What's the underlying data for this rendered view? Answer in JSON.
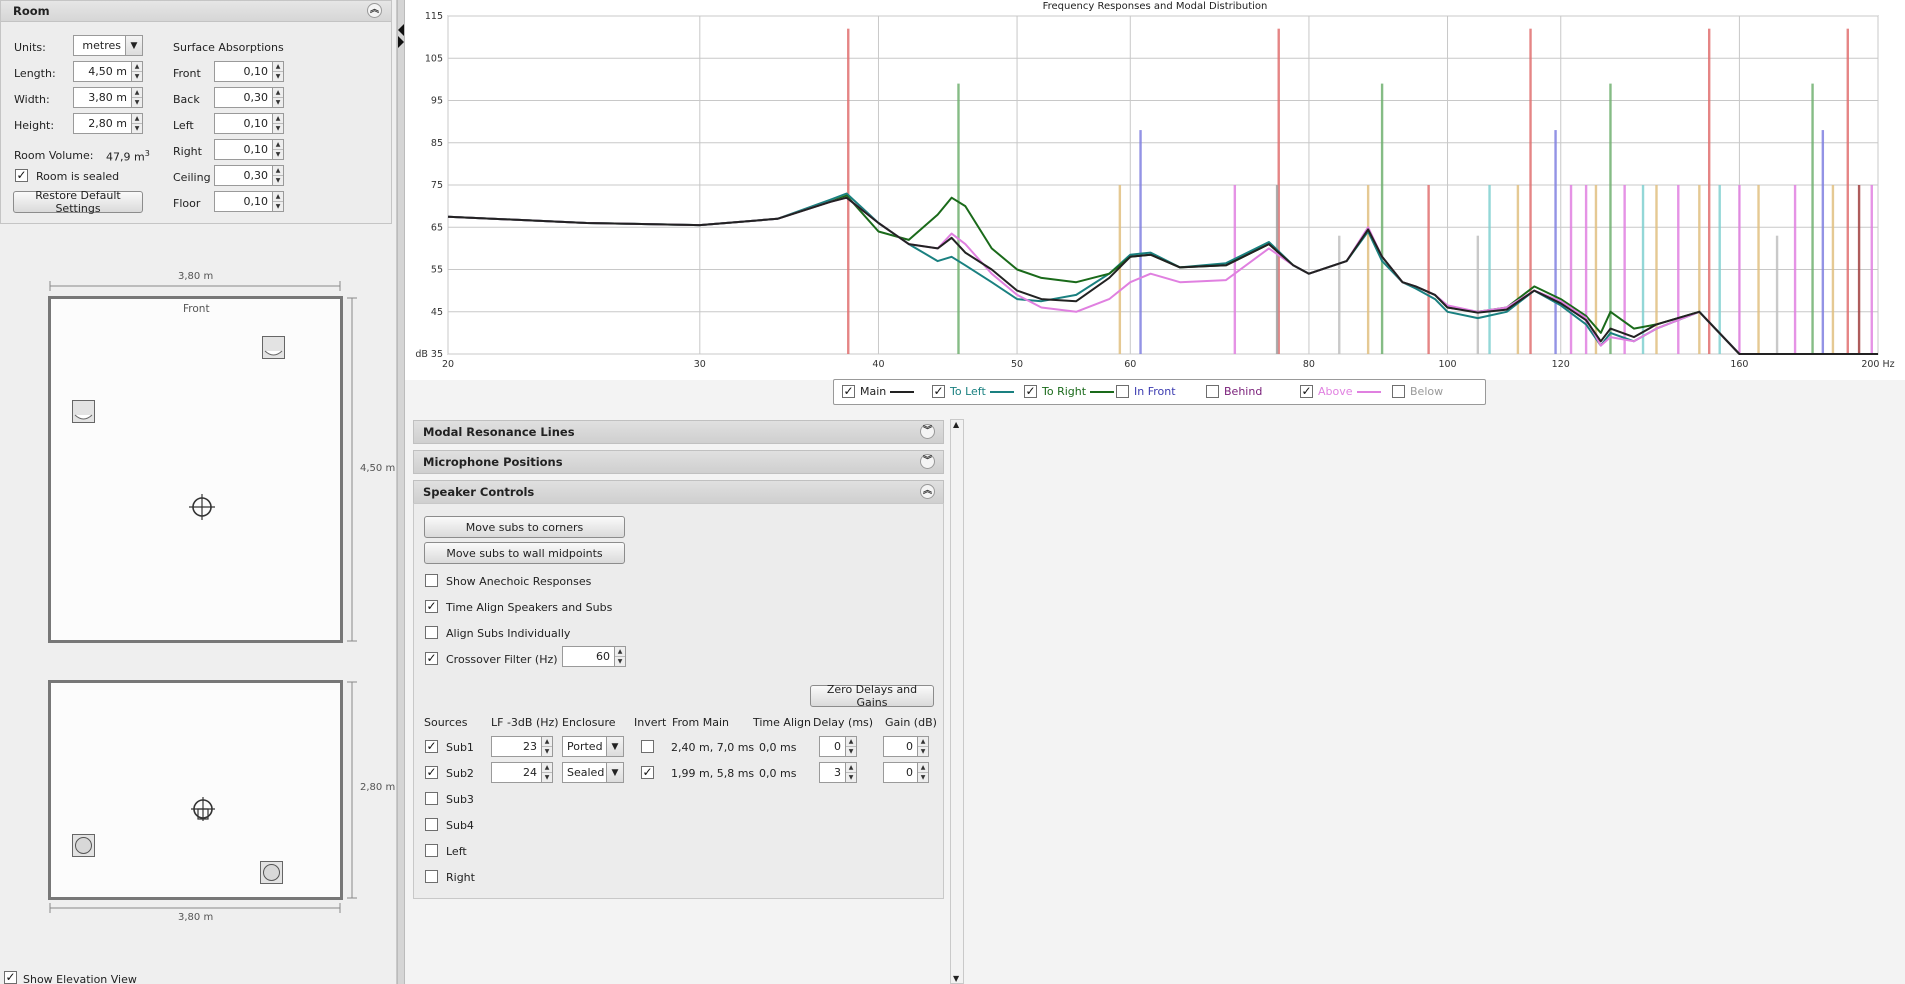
{
  "room": {
    "title": "Room",
    "units_label": "Units:",
    "units_value": "metres",
    "length_label": "Length:",
    "length_value": "4,50 m",
    "width_label": "Width:",
    "width_value": "3,80 m",
    "height_label": "Height:",
    "height_value": "2,80 m",
    "volume_label": "Room Volume:",
    "volume_value": "47,9 m",
    "volume_sup": "3",
    "sealed_label": "Room is sealed",
    "sealed_checked": true,
    "restore_label": "Restore Default Settings",
    "absorptions_title": "Surface Absorptions",
    "absorptions": [
      {
        "label": "Front",
        "value": "0,10"
      },
      {
        "label": "Back",
        "value": "0,30"
      },
      {
        "label": "Left",
        "value": "0,10"
      },
      {
        "label": "Right",
        "value": "0,10"
      },
      {
        "label": "Ceiling",
        "value": "0,30"
      },
      {
        "label": "Floor",
        "value": "0,10"
      }
    ]
  },
  "plan": {
    "top_width": "3,80 m",
    "front_label": "Front",
    "length": "4,50 m",
    "elev_height": "2,80 m",
    "elev_width": "3,80 m"
  },
  "elevation_toggle": {
    "label": "Show Elevation View",
    "checked": true
  },
  "chart_data": {
    "type": "line",
    "title": "Frequency Responses and Modal Distribution",
    "xlabel": "Hz",
    "ylabel": "dB",
    "x_scale": "log",
    "xlim": [
      20,
      200
    ],
    "ylim": [
      35,
      115
    ],
    "x_ticks": [
      "20",
      "30",
      "40",
      "50",
      "60",
      "80",
      "100",
      "120",
      "160",
      "200 Hz"
    ],
    "y_ticks": [
      "dB 35",
      "45",
      "55",
      "65",
      "75",
      "85",
      "95",
      "105",
      "115"
    ],
    "grid": true,
    "series": [
      {
        "name": "Main",
        "color": "#222222",
        "x": [
          20,
          25,
          30,
          34,
          37,
          38,
          40,
          42,
          44,
          45,
          46,
          48,
          50,
          52,
          55,
          58,
          60,
          62,
          65,
          70,
          75,
          78,
          80,
          85,
          88,
          90,
          93,
          95,
          98,
          100,
          105,
          110,
          115,
          120,
          125,
          128,
          130,
          135,
          140,
          150,
          160,
          200
        ],
        "y": [
          67.5,
          66,
          65.5,
          67,
          71,
          72,
          66,
          61,
          60,
          62.5,
          59,
          55,
          50,
          48,
          47.5,
          53,
          58,
          58.5,
          55.5,
          56,
          61,
          56,
          54,
          57,
          64.5,
          58,
          52,
          51,
          49,
          46,
          44.8,
          45.5,
          50,
          47,
          43,
          38,
          41,
          39,
          42,
          45,
          35,
          35
        ]
      },
      {
        "name": "To Left",
        "color": "#1a8080",
        "x": [
          20,
          25,
          30,
          34,
          37,
          38,
          40,
          42,
          44,
          45,
          46,
          48,
          50,
          52,
          55,
          58,
          60,
          62,
          65,
          70,
          75,
          78,
          80,
          85,
          88,
          90,
          93,
          95,
          98,
          100,
          105,
          110,
          115,
          120,
          125,
          128,
          130,
          135,
          140,
          150,
          160,
          200
        ],
        "y": [
          67.5,
          66,
          65.5,
          67,
          71.5,
          73,
          66,
          61,
          57,
          58,
          56,
          52,
          48,
          47.5,
          49,
          54,
          58.5,
          59,
          55.5,
          56.5,
          61.5,
          56,
          54,
          57,
          64,
          57,
          52,
          50.5,
          48,
          45,
          43.5,
          45,
          50,
          46.5,
          42,
          37,
          40,
          38,
          41,
          45,
          35,
          35
        ]
      },
      {
        "name": "To Right",
        "color": "#1a6a1a",
        "x": [
          20,
          25,
          30,
          34,
          37,
          38,
          40,
          42,
          44,
          45,
          46,
          48,
          50,
          52,
          55,
          58,
          60,
          62,
          65,
          70,
          75,
          78,
          80,
          85,
          88,
          90,
          93,
          95,
          98,
          100,
          105,
          110,
          115,
          120,
          125,
          128,
          130,
          135,
          140,
          150,
          160,
          200
        ],
        "y": [
          67.5,
          66,
          65.5,
          67,
          71,
          72.5,
          64,
          62,
          68,
          72,
          70,
          60,
          55,
          53,
          52,
          54,
          58,
          58.5,
          55.5,
          56,
          61,
          56,
          54,
          57,
          64.5,
          58,
          52,
          51,
          49,
          46,
          45,
          46,
          51,
          48,
          44,
          40,
          45,
          41,
          42,
          45,
          35,
          35
        ]
      },
      {
        "name": "In Front",
        "color": "#3b3bb0",
        "x": [],
        "y": [],
        "enabled": false
      },
      {
        "name": "Behind",
        "color": "#7a207a",
        "x": [],
        "y": [],
        "enabled": false
      },
      {
        "name": "Above",
        "color": "#e080e0",
        "x": [
          20,
          25,
          30,
          34,
          37,
          38,
          40,
          42,
          44,
          45,
          46,
          48,
          50,
          52,
          55,
          58,
          60,
          62,
          65,
          70,
          75,
          78,
          80,
          85,
          88,
          90,
          93,
          95,
          98,
          100,
          105,
          110,
          115,
          120,
          125,
          128,
          130,
          135,
          140,
          150,
          160,
          200
        ],
        "y": [
          67.5,
          66,
          65.5,
          67,
          71,
          72,
          66,
          61,
          60,
          63.5,
          61,
          54,
          49,
          46,
          45,
          48,
          52,
          54,
          52,
          52.5,
          60,
          56,
          54,
          57,
          65,
          58,
          52,
          51,
          49,
          46.5,
          45,
          46,
          50,
          47.5,
          43.5,
          37,
          39,
          38,
          41,
          45,
          35,
          35
        ]
      },
      {
        "name": "Below",
        "color": "#999999",
        "x": [],
        "y": [],
        "enabled": false
      }
    ],
    "modal_lines": [
      {
        "x": 38.1,
        "height": 112,
        "color": "#e07070"
      },
      {
        "x": 45.5,
        "height": 99,
        "color": "#70b070"
      },
      {
        "x": 61,
        "height": 88,
        "color": "#8080e0"
      },
      {
        "x": 59,
        "height": 75,
        "color": "#e0c080"
      },
      {
        "x": 71,
        "height": 75,
        "color": "#e080e0"
      },
      {
        "x": 76.2,
        "height": 112,
        "color": "#e07070"
      },
      {
        "x": 76,
        "height": 75,
        "color": "#a0a0a0"
      },
      {
        "x": 84,
        "height": 63,
        "color": "#c0c0c0"
      },
      {
        "x": 88,
        "height": 75,
        "color": "#e0c080"
      },
      {
        "x": 90,
        "height": 99,
        "color": "#70b070"
      },
      {
        "x": 97,
        "height": 75,
        "color": "#e07070"
      },
      {
        "x": 105,
        "height": 63,
        "color": "#c0c0c0"
      },
      {
        "x": 107,
        "height": 75,
        "color": "#80d0d0"
      },
      {
        "x": 112,
        "height": 75,
        "color": "#e0c080"
      },
      {
        "x": 114.3,
        "height": 112,
        "color": "#e07070"
      },
      {
        "x": 119,
        "height": 88,
        "color": "#8080e0"
      },
      {
        "x": 122,
        "height": 75,
        "color": "#e080e0"
      },
      {
        "x": 125,
        "height": 75,
        "color": "#e080e0"
      },
      {
        "x": 127,
        "height": 75,
        "color": "#e0c080"
      },
      {
        "x": 130,
        "height": 99,
        "color": "#70b070"
      },
      {
        "x": 133,
        "height": 75,
        "color": "#e080e0"
      },
      {
        "x": 137,
        "height": 75,
        "color": "#80d0d0"
      },
      {
        "x": 140,
        "height": 75,
        "color": "#e0c080"
      },
      {
        "x": 145,
        "height": 75,
        "color": "#e080e0"
      },
      {
        "x": 150,
        "height": 75,
        "color": "#e0c080"
      },
      {
        "x": 152.4,
        "height": 112,
        "color": "#e07070"
      },
      {
        "x": 155,
        "height": 75,
        "color": "#80d0d0"
      },
      {
        "x": 160,
        "height": 75,
        "color": "#e080e0"
      },
      {
        "x": 165,
        "height": 75,
        "color": "#e0c080"
      },
      {
        "x": 170,
        "height": 63,
        "color": "#c0c0c0"
      },
      {
        "x": 175,
        "height": 75,
        "color": "#e080e0"
      },
      {
        "x": 180,
        "height": 99,
        "color": "#70b070"
      },
      {
        "x": 183,
        "height": 88,
        "color": "#8080e0"
      },
      {
        "x": 186,
        "height": 75,
        "color": "#e0c080"
      },
      {
        "x": 190.5,
        "height": 112,
        "color": "#e07070"
      },
      {
        "x": 194,
        "height": 75,
        "color": "#a04040"
      },
      {
        "x": 198,
        "height": 75,
        "color": "#e080e0"
      }
    ]
  },
  "legend": [
    {
      "label": "Main",
      "checked": true,
      "color": "#222222",
      "text_color": "#222222",
      "line": true
    },
    {
      "label": "To Left",
      "checked": true,
      "color": "#1a8080",
      "text_color": "#1a8080",
      "line": true
    },
    {
      "label": "To Right",
      "checked": true,
      "color": "#1a6a1a",
      "text_color": "#1a6a1a",
      "line": true
    },
    {
      "label": "In Front",
      "checked": false,
      "color": "#3b3bb0",
      "text_color": "#3b3bb0",
      "line": false
    },
    {
      "label": "Behind",
      "checked": false,
      "color": "#7a207a",
      "text_color": "#7a207a",
      "line": false
    },
    {
      "label": "Above",
      "checked": true,
      "color": "#e080e0",
      "text_color": "#e080e0",
      "line": true
    },
    {
      "label": "Below",
      "checked": false,
      "color": "#999999",
      "text_color": "#999999",
      "line": false
    }
  ],
  "sections": {
    "modal": "Modal Resonance Lines",
    "mics": "Microphone Positions",
    "speakers": "Speaker Controls"
  },
  "speaker_controls": {
    "move_corners": "Move subs to corners",
    "move_midpoints": "Move subs to wall midpoints",
    "options": [
      {
        "label": "Show Anechoic Responses",
        "checked": false
      },
      {
        "label": "Time Align Speakers and Subs",
        "checked": true
      },
      {
        "label": "Align Subs Individually",
        "checked": false
      },
      {
        "label": "Crossover Filter (Hz)",
        "checked": true
      }
    ],
    "crossover_value": "60",
    "zero_button": "Zero Delays and Gains",
    "headers": [
      "Sources",
      "LF -3dB (Hz)",
      "Enclosure",
      "Invert",
      "From Main",
      "Time Align",
      "Delay (ms)",
      "Gain (dB)"
    ],
    "sources": [
      {
        "name": "Sub1",
        "checked": true,
        "lf": "23",
        "enclosure": "Ported",
        "invert": false,
        "from_main": "2,40 m, 7,0 ms",
        "time_align": "0,0 ms",
        "delay": "0",
        "gain": "0"
      },
      {
        "name": "Sub2",
        "checked": true,
        "lf": "24",
        "enclosure": "Sealed",
        "invert": true,
        "from_main": "1,99 m, 5,8 ms",
        "time_align": "0,0 ms",
        "delay": "3",
        "gain": "0"
      },
      {
        "name": "Sub3",
        "checked": false
      },
      {
        "name": "Sub4",
        "checked": false
      },
      {
        "name": "Left",
        "checked": false
      },
      {
        "name": "Right",
        "checked": false
      }
    ]
  }
}
